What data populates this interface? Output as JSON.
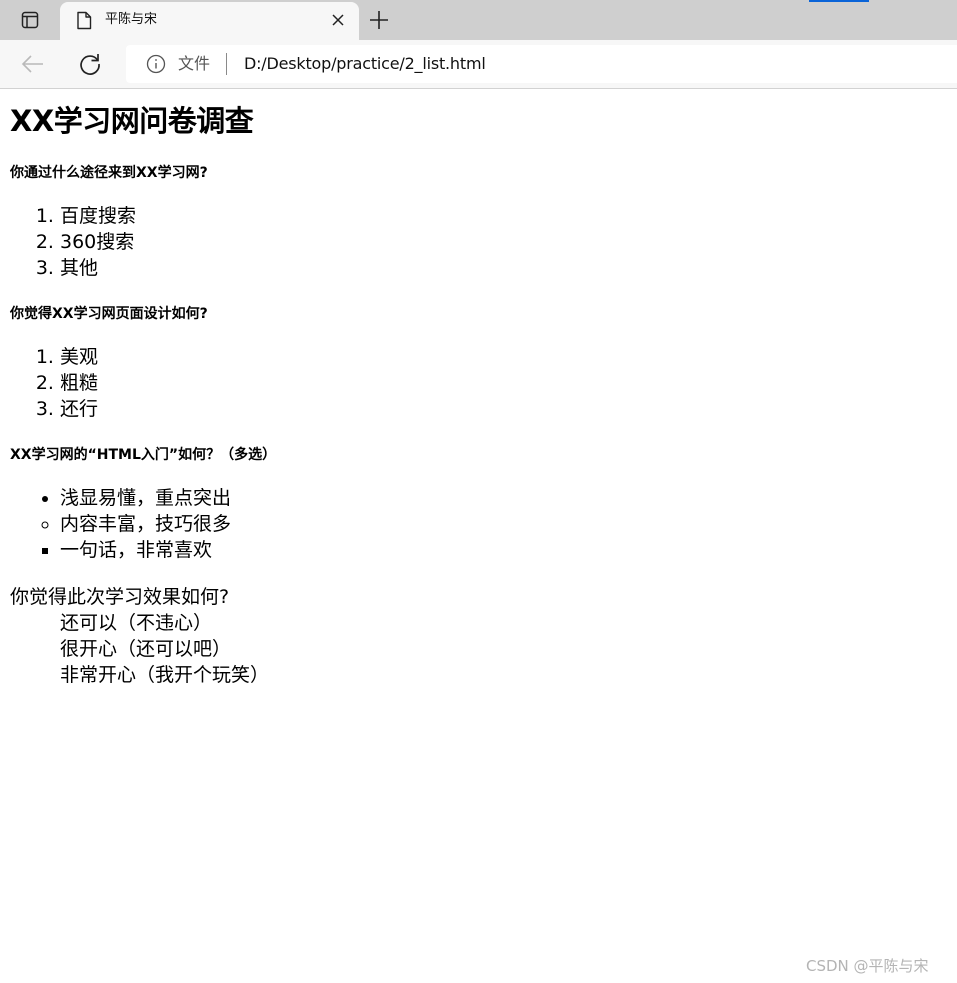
{
  "browser": {
    "tab_title": "平陈与宋",
    "address_scheme": "文件",
    "address_url": "D:/Desktop/practice/2_list.html"
  },
  "page": {
    "title": "XX学习网问卷调查",
    "q1": {
      "question": "你通过什么途径来到XX学习网?",
      "options": [
        "百度搜索",
        "360搜索",
        "其他"
      ]
    },
    "q2": {
      "question": "你觉得XX学习网页面设计如何?",
      "options": [
        "美观",
        "粗糙",
        "还行"
      ]
    },
    "q3": {
      "question": "XX学习网的“HTML入门”如何？（多选）",
      "options": [
        "浅显易懂，重点突出",
        "内容丰富，技巧很多",
        "一句话，非常喜欢"
      ]
    },
    "q4": {
      "term": "你觉得此次学习效果如何?",
      "options": [
        "还可以（不违心）",
        "很开心（还可以吧）",
        "非常开心（我开个玩笑）"
      ]
    }
  },
  "watermark": "CSDN @平陈与宋"
}
